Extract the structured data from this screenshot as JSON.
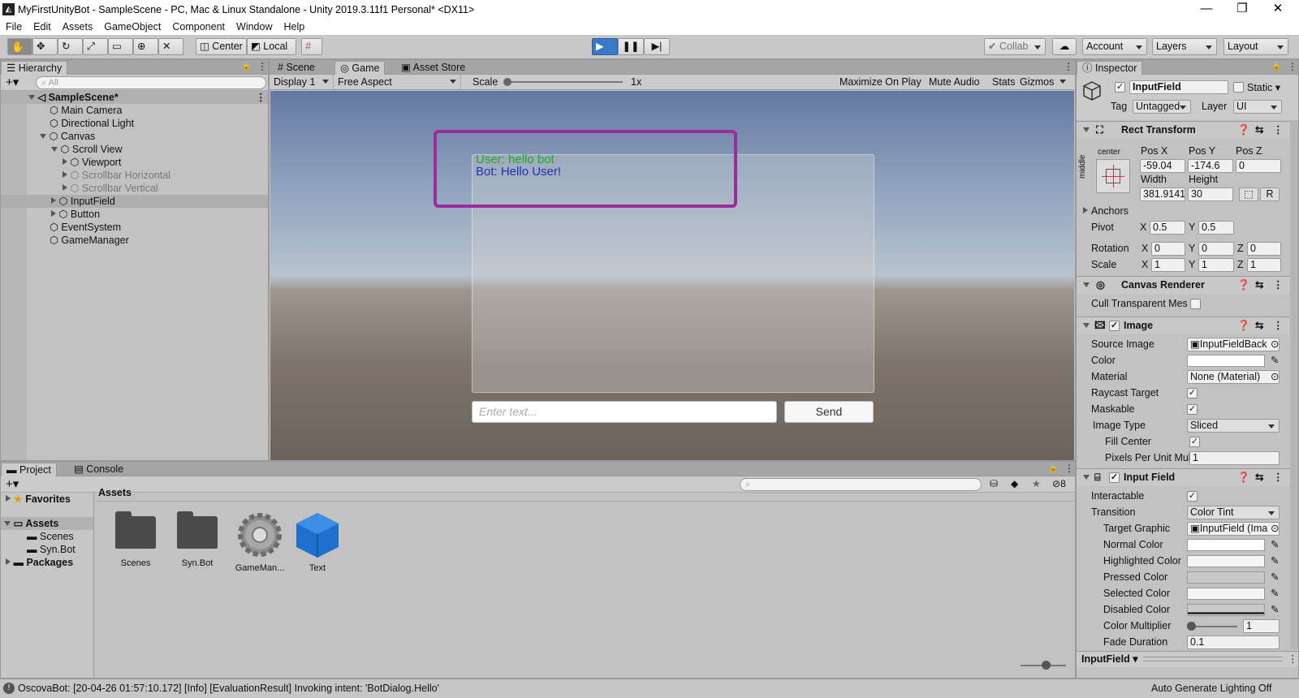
{
  "window": {
    "title": "MyFirstUnityBot - SampleScene - PC, Mac & Linux Standalone - Unity 2019.3.11f1 Personal* <DX11>",
    "min": "—",
    "max": "❐",
    "close": "✕"
  },
  "menu": [
    "File",
    "Edit",
    "Assets",
    "GameObject",
    "Component",
    "Window",
    "Help"
  ],
  "toolbar": {
    "center": "Center",
    "local": "Local",
    "collab": "Collab",
    "account": "Account",
    "layers": "Layers",
    "layout": "Layout"
  },
  "hierarchy": {
    "tab": "Hierarchy",
    "search_placeholder": "All",
    "scene": "SampleScene*",
    "items": [
      "Main Camera",
      "Directional Light",
      "Canvas",
      "Scroll View",
      "Viewport",
      "Scrollbar Horizontal",
      "Scrollbar Vertical",
      "InputField",
      "Button",
      "EventSystem",
      "GameManager"
    ]
  },
  "game": {
    "tabs": [
      "Scene",
      "Game",
      "Asset Store"
    ],
    "display": "Display 1",
    "aspect": "Free Aspect",
    "scale_label": "Scale",
    "scale_value": "1x",
    "maximize": "Maximize On Play",
    "mute": "Mute Audio",
    "stats": "Stats",
    "gizmos": "Gizmos",
    "chat_user": "User: hello bot",
    "chat_bot": "Bot: Hello User!",
    "input_placeholder": "Enter text...",
    "send": "Send",
    "colors": {
      "user": "#22a822",
      "bot": "#2233aa",
      "highlight": "#9b2c9b"
    }
  },
  "project": {
    "tabs": [
      "Project",
      "Console"
    ],
    "hidden_count": "8",
    "favorites": "Favorites",
    "assets": "Assets",
    "scenes": "Scenes",
    "synbot": "Syn.Bot",
    "packages": "Packages",
    "breadcrumb": "Assets",
    "grid": [
      "Scenes",
      "Syn.Bot",
      "GameMan...",
      "Text"
    ]
  },
  "inspector": {
    "tab": "Inspector",
    "object_name": "InputField",
    "static": "Static",
    "tag_label": "Tag",
    "tag": "Untagged",
    "layer_label": "Layer",
    "layer": "UI",
    "rect_transform": {
      "title": "Rect Transform",
      "anchor_h": "center",
      "anchor_v": "middle",
      "posx_label": "Pos X",
      "posy_label": "Pos Y",
      "posz_label": "Pos Z",
      "posx": "-59.04",
      "posy": "-174.6",
      "posz": "0",
      "width_label": "Width",
      "height_label": "Height",
      "width": "381.9141",
      "height": "30",
      "r": "R",
      "anchors": "Anchors",
      "pivot": "Pivot",
      "pivot_x": "0.5",
      "pivot_y": "0.5",
      "rotation": "Rotation",
      "rot_x": "0",
      "rot_y": "0",
      "rot_z": "0",
      "scale": "Scale",
      "scale_x": "1",
      "scale_y": "1",
      "scale_z": "1",
      "x": "X",
      "y": "Y",
      "z": "Z"
    },
    "canvas_renderer": {
      "title": "Canvas Renderer",
      "cull": "Cull Transparent Mes"
    },
    "image": {
      "title": "Image",
      "source_image": "Source Image",
      "source_value": "InputFieldBack",
      "color": "Color",
      "material": "Material",
      "material_value": "None (Material)",
      "raycast": "Raycast Target",
      "maskable": "Maskable",
      "image_type": "Image Type",
      "image_type_value": "Sliced",
      "fill_center": "Fill Center",
      "ppu": "Pixels Per Unit Mul",
      "ppu_value": "1"
    },
    "input_field": {
      "title": "Input Field",
      "interactable": "Interactable",
      "transition": "Transition",
      "transition_value": "Color Tint",
      "target_graphic": "Target Graphic",
      "target_value": "InputField (Ima",
      "normal": "Normal Color",
      "highlighted": "Highlighted Color",
      "pressed": "Pressed Color",
      "selected": "Selected Color",
      "disabled": "Disabled Color",
      "multiplier": "Color Multiplier",
      "multiplier_value": "1",
      "fade": "Fade Duration",
      "fade_value": "0.1"
    },
    "footer": "InputField"
  },
  "status": {
    "message": "OscovaBot: [20-04-26 01:57:10.172] [Info] [EvaluationResult] Invoking intent: 'BotDialog.Hello'",
    "lighting": "Auto Generate Lighting Off"
  }
}
